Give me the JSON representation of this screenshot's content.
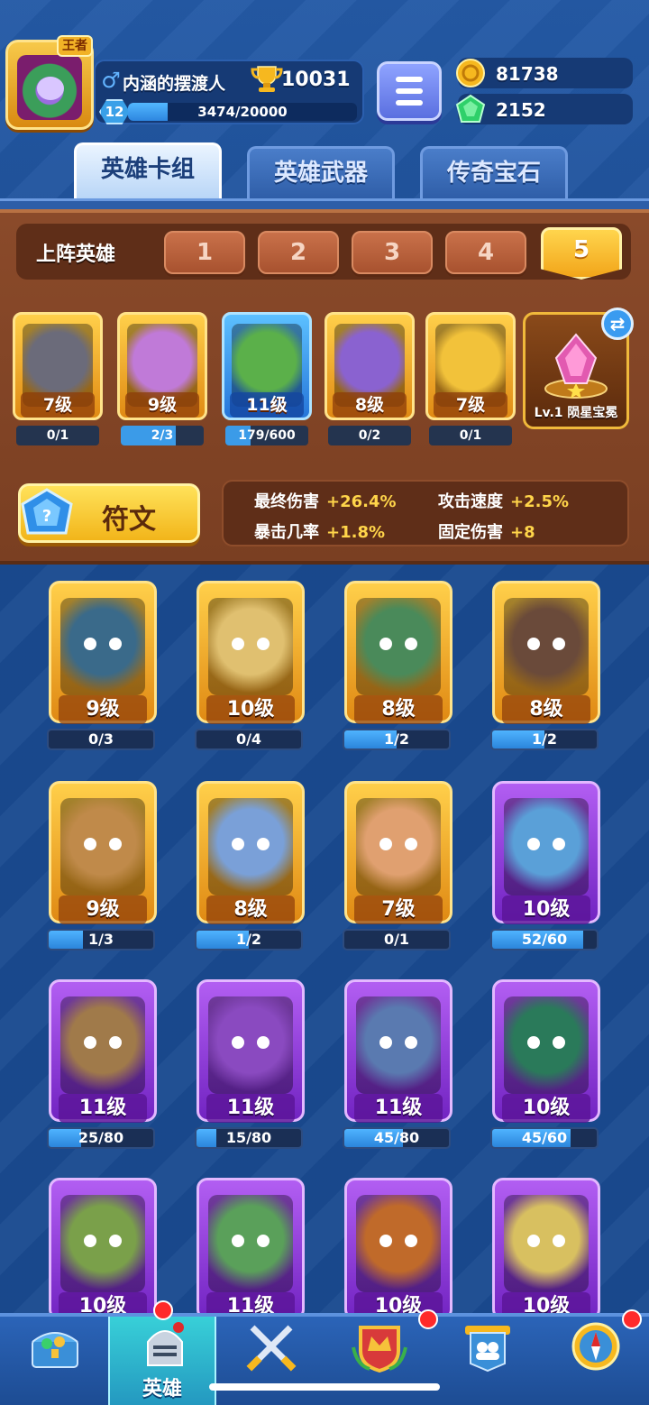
{
  "player": {
    "crown_label": "王者",
    "name": "内涵的摆渡人",
    "trophies": "10031",
    "level": "12",
    "xp_text": "3474/20000",
    "xp_fraction": 0.1737
  },
  "currency": {
    "gold": "81738",
    "gems": "2152"
  },
  "tabs": [
    {
      "label": "英雄卡组",
      "active": true
    },
    {
      "label": "英雄武器",
      "active": false
    },
    {
      "label": "传奇宝石",
      "active": false
    }
  ],
  "lineup": {
    "title": "上阵英雄",
    "slots": [
      "1",
      "2",
      "3",
      "4",
      "5"
    ],
    "active_slot": "5",
    "heroes": [
      {
        "level": "7级",
        "progress": "0/1",
        "fraction": 0.0,
        "rarity": "legend",
        "color": "#6b6b7a"
      },
      {
        "level": "9级",
        "progress": "2/3",
        "fraction": 0.66,
        "rarity": "legend",
        "color": "#c07ad8"
      },
      {
        "level": "11级",
        "progress": "179/600",
        "fraction": 0.3,
        "rarity": "rare",
        "color": "#5bb04a"
      },
      {
        "level": "8级",
        "progress": "0/2",
        "fraction": 0.0,
        "rarity": "legend",
        "color": "#8a62d0"
      },
      {
        "level": "7级",
        "progress": "0/1",
        "fraction": 0.0,
        "rarity": "legend",
        "color": "#f2c23a"
      }
    ],
    "gem_label": "Lv.1 陨星宝冕",
    "rune_label": "符文",
    "stats": [
      {
        "key": "最终伤害",
        "value": "+26.4%"
      },
      {
        "key": "攻击速度",
        "value": "+2.5%"
      },
      {
        "key": "暴击几率",
        "value": "+1.8%"
      },
      {
        "key": "固定伤害",
        "value": "+8"
      }
    ]
  },
  "collection": [
    {
      "level": "9级",
      "progress": "0/3",
      "fraction": 0.0,
      "rarity": "legend",
      "color": "#3a6a8a"
    },
    {
      "level": "10级",
      "progress": "0/4",
      "fraction": 0.0,
      "rarity": "legend",
      "color": "#e0c070"
    },
    {
      "level": "8级",
      "progress": "1/2",
      "fraction": 0.5,
      "rarity": "legend",
      "color": "#4a8a5a"
    },
    {
      "level": "8级",
      "progress": "1/2",
      "fraction": 0.5,
      "rarity": "legend",
      "color": "#6a4a3a"
    },
    {
      "level": "9级",
      "progress": "1/3",
      "fraction": 0.33,
      "rarity": "legend",
      "color": "#c08a4a"
    },
    {
      "level": "8级",
      "progress": "1/2",
      "fraction": 0.5,
      "rarity": "legend",
      "color": "#7aa0d8"
    },
    {
      "level": "7级",
      "progress": "0/1",
      "fraction": 0.0,
      "rarity": "legend",
      "color": "#e0a070"
    },
    {
      "level": "10级",
      "progress": "52/60",
      "fraction": 0.87,
      "rarity": "epic",
      "color": "#5aa0d8"
    },
    {
      "level": "11级",
      "progress": "25/80",
      "fraction": 0.31,
      "rarity": "epic",
      "color": "#a07a4a"
    },
    {
      "level": "11级",
      "progress": "15/80",
      "fraction": 0.19,
      "rarity": "epic",
      "color": "#8a4ac0"
    },
    {
      "level": "11级",
      "progress": "45/80",
      "fraction": 0.56,
      "rarity": "epic",
      "color": "#5a7ab0"
    },
    {
      "level": "10级",
      "progress": "45/60",
      "fraction": 0.75,
      "rarity": "epic",
      "color": "#2a7a5a"
    },
    {
      "level": "10级",
      "progress": "",
      "fraction": 0.0,
      "rarity": "epic",
      "color": "#7aa04a"
    },
    {
      "level": "11级",
      "progress": "",
      "fraction": 0.0,
      "rarity": "epic",
      "color": "#5aa05a"
    },
    {
      "level": "10级",
      "progress": "",
      "fraction": 0.0,
      "rarity": "epic",
      "color": "#c06a2a"
    },
    {
      "level": "10级",
      "progress": "",
      "fraction": 0.0,
      "rarity": "epic",
      "color": "#d8c060"
    }
  ],
  "nav": [
    {
      "icon": "treasure-chest-icon",
      "label": "",
      "active": false,
      "badge": false
    },
    {
      "icon": "knight-helmet-icon",
      "label": "英雄",
      "active": true,
      "badge": true
    },
    {
      "icon": "crossed-swords-icon",
      "label": "",
      "active": false,
      "badge": false
    },
    {
      "icon": "crown-shield-icon",
      "label": "",
      "active": false,
      "badge": true
    },
    {
      "icon": "guild-banner-icon",
      "label": "",
      "active": false,
      "badge": false
    },
    {
      "icon": "compass-icon",
      "label": "",
      "active": false,
      "badge": true
    }
  ]
}
